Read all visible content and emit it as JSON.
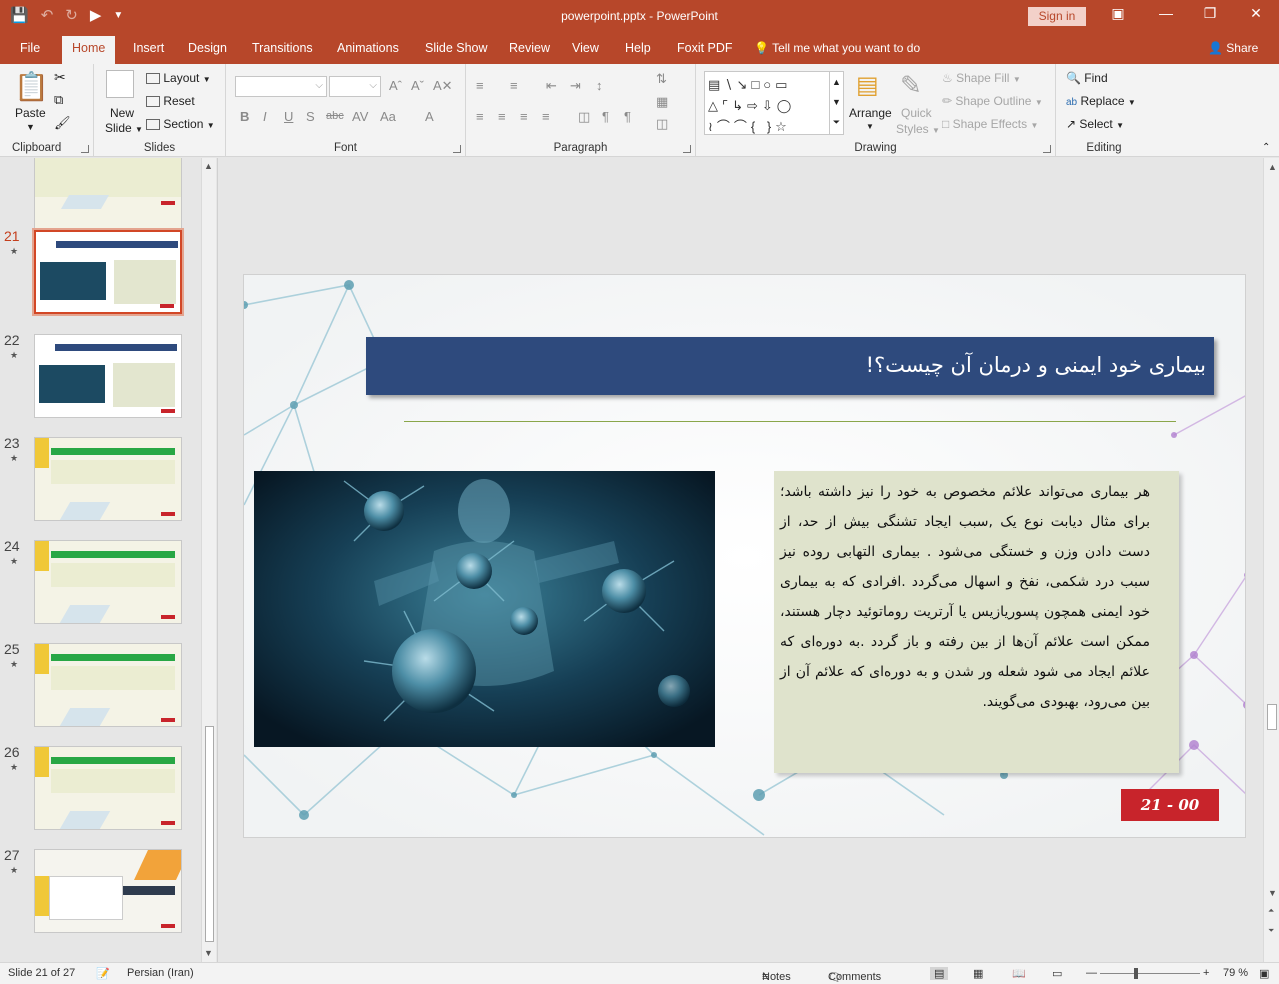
{
  "window": {
    "title": "powerpoint.pptx  -  PowerPoint",
    "sign_in": "Sign in"
  },
  "tabs": [
    "File",
    "Home",
    "Insert",
    "Design",
    "Transitions",
    "Animations",
    "Slide Show",
    "Review",
    "View",
    "Help",
    "Foxit PDF"
  ],
  "tell_me": "Tell me what you want to do",
  "share": "Share",
  "ribbon": {
    "clipboard": {
      "label": "Clipboard",
      "paste": "Paste"
    },
    "slides": {
      "label": "Slides",
      "new_slide_1": "New",
      "new_slide_2": "Slide",
      "layout": "Layout",
      "reset": "Reset",
      "section": "Section"
    },
    "font": {
      "label": "Font"
    },
    "paragraph": {
      "label": "Paragraph"
    },
    "drawing": {
      "label": "Drawing",
      "arrange": "Arrange",
      "quick_styles_1": "Quick",
      "quick_styles_2": "Styles",
      "shape_fill": "Shape Fill",
      "shape_outline": "Shape Outline",
      "shape_effects": "Shape Effects"
    },
    "editing": {
      "label": "Editing",
      "find": "Find",
      "replace": "Replace",
      "select": "Select"
    }
  },
  "thumbnails": [
    {
      "number": "",
      "variant": "yellow-top"
    },
    {
      "number": "21",
      "variant": "blue",
      "selected": true
    },
    {
      "number": "22",
      "variant": "blue2"
    },
    {
      "number": "23",
      "variant": "green"
    },
    {
      "number": "24",
      "variant": "green"
    },
    {
      "number": "25",
      "variant": "green"
    },
    {
      "number": "26",
      "variant": "green"
    },
    {
      "number": "27",
      "variant": "end"
    }
  ],
  "slide": {
    "title": "بیماری خود ایمنی و درمان آن چیست؟!",
    "body": "هر بیماری می‌تواند علائم مخصوص به خود را نیز داشته باشد؛ برای مثال دیابت نوع یک ,سبب ایجاد تشنگی بیش از حد، از دست دادن وزن و خستگی می‌شود . بیماری التهابی روده نیز سبب درد شکمی، نفخ و اسهال می‌گردد .افرادی که به بیماری خود ایمنی همچون پسوریازیس یا آرتریت روماتوئید دچار هستند، ممکن است علائم آن‌ها از بین رفته و باز گردد .به دوره‌ای که علائم ایجاد می شود شعله ور شدن و به دوره‌ای که علائم آن از بین می‌رود، بهبودی می‌گویند.",
    "page_label": "21  -  00"
  },
  "status": {
    "slide_info": "Slide 21 of 27",
    "language": "Persian (Iran)",
    "notes": "Notes",
    "comments": "Comments",
    "zoom": "79 %"
  },
  "colors": {
    "accent": "#b7472a",
    "title_bar": "#2e4a7d",
    "text_box": "#dfe3cc",
    "page_box": "#c8242b"
  }
}
